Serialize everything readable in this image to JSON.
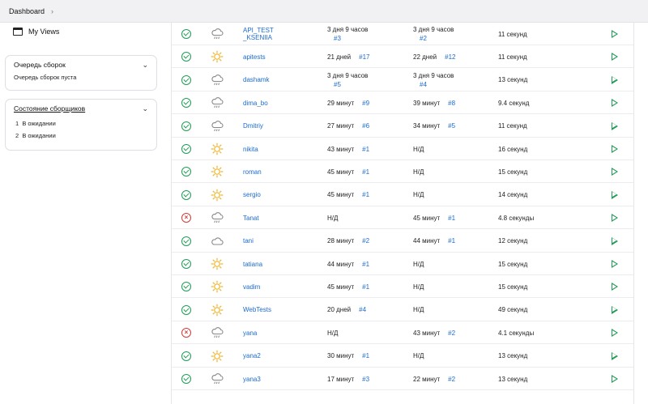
{
  "breadcrumb": {
    "label": "Dashboard"
  },
  "sidebar": {
    "my_views": "My Views",
    "queue": {
      "title": "Очередь сборок",
      "body": "Очередь сборок пуста"
    },
    "executors": {
      "title": "Состояние сборщиков",
      "items": [
        {
          "index": "1",
          "status": "В ожидании"
        },
        {
          "index": "2",
          "status": "В ожидании"
        }
      ]
    }
  },
  "jobs": [
    {
      "status": "ok",
      "weather": "rain-cloud-icon",
      "name": "API_TEST_KSENIIA",
      "name_line1": "API_TEST",
      "name_line2": "_KSENIIA",
      "last_success": "3 дня 9 часов",
      "last_success_num": "#3",
      "last_failure": "3 дня 9 часов",
      "last_failure_num": "#2",
      "duration": "11 секунд"
    },
    {
      "status": "ok",
      "weather": "sun-icon",
      "name": "apitests",
      "last_success": "21 дней",
      "last_success_num": "#17",
      "last_failure": "22 дней",
      "last_failure_num": "#12",
      "duration": "11 секунд"
    },
    {
      "status": "ok",
      "weather": "rain-cloud-icon",
      "name": "dashamk",
      "last_success": "3 дня 9 часов",
      "last_success_num": "#5",
      "last_failure": "3 дня 9 часов",
      "last_failure_num": "#4",
      "duration": "13 секунд"
    },
    {
      "status": "ok",
      "weather": "rain-cloud-icon",
      "name": "dima_bo",
      "last_success": "29 минут",
      "last_success_num": "#9",
      "last_failure": "39 минут",
      "last_failure_num": "#8",
      "duration": "9.4 секунд"
    },
    {
      "status": "ok",
      "weather": "rain-cloud-icon",
      "name": "Dmitriy",
      "last_success": "27 минут",
      "last_success_num": "#6",
      "last_failure": "34 минут",
      "last_failure_num": "#5",
      "duration": "11 секунд"
    },
    {
      "status": "ok",
      "weather": "sun-icon",
      "name": "nikita",
      "last_success": "43 минут",
      "last_success_num": "#1",
      "last_failure": "Н/Д",
      "last_failure_num": "",
      "duration": "16 секунд"
    },
    {
      "status": "ok",
      "weather": "sun-icon",
      "name": "roman",
      "last_success": "45 минут",
      "last_success_num": "#1",
      "last_failure": "Н/Д",
      "last_failure_num": "",
      "duration": "15 секунд"
    },
    {
      "status": "ok",
      "weather": "sun-icon",
      "name": "sergio",
      "last_success": "45 минут",
      "last_success_num": "#1",
      "last_failure": "Н/Д",
      "last_failure_num": "",
      "duration": "14 секунд"
    },
    {
      "status": "fail",
      "weather": "rain-cloud-icon",
      "name": "Tanat",
      "last_success": "Н/Д",
      "last_success_num": "",
      "last_failure": "45 минут",
      "last_failure_num": "#1",
      "duration": "4.8 секунды"
    },
    {
      "status": "ok",
      "weather": "cloud-icon",
      "name": "tani",
      "last_success": "28 минут",
      "last_success_num": "#2",
      "last_failure": "44 минут",
      "last_failure_num": "#1",
      "duration": "12 секунд"
    },
    {
      "status": "ok",
      "weather": "sun-icon",
      "name": "tatiana",
      "last_success": "44 минут",
      "last_success_num": "#1",
      "last_failure": "Н/Д",
      "last_failure_num": "",
      "duration": "15 секунд"
    },
    {
      "status": "ok",
      "weather": "sun-icon",
      "name": "vadim",
      "last_success": "45 минут",
      "last_success_num": "#1",
      "last_failure": "Н/Д",
      "last_failure_num": "",
      "duration": "15 секунд"
    },
    {
      "status": "ok",
      "weather": "sun-icon",
      "name": "WebTests",
      "last_success": "20 дней",
      "last_success_num": "#4",
      "last_failure": "Н/Д",
      "last_failure_num": "",
      "duration": "49 секунд"
    },
    {
      "status": "fail",
      "weather": "rain-cloud-icon",
      "name": "yana",
      "last_success": "Н/Д",
      "last_success_num": "",
      "last_failure": "43 минут",
      "last_failure_num": "#2",
      "duration": "4.1 секунды"
    },
    {
      "status": "ok",
      "weather": "sun-icon",
      "name": "yana2",
      "last_success": "30 минут",
      "last_success_num": "#1",
      "last_failure": "Н/Д",
      "last_failure_num": "",
      "duration": "13 секунд"
    },
    {
      "status": "ok",
      "weather": "rain-cloud-icon",
      "name": "yana3",
      "last_success": "17 минут",
      "last_success_num": "#3",
      "last_failure": "22 минут",
      "last_failure_num": "#2",
      "duration": "13 секунд"
    }
  ],
  "colors": {
    "success": "#1f9d55",
    "failure": "#d63a3a",
    "link": "#1a6bd1",
    "sun": "#f0b429",
    "cloud": "#888888"
  }
}
